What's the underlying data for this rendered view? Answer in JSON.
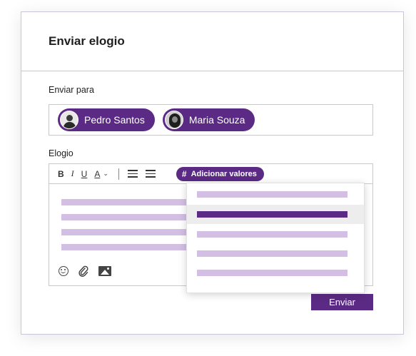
{
  "dialog": {
    "title": "Enviar elogio",
    "send_to_label": "Enviar para",
    "recipients": [
      {
        "name": "Pedro Santos"
      },
      {
        "name": "Maria Souza"
      }
    ],
    "message_label": "Elogio",
    "toolbar": {
      "bold": "B",
      "italic": "I",
      "underline": "U",
      "font_color": "A",
      "add_values": "Adicionar valores",
      "add_values_hash": "#"
    },
    "dropdown": {
      "item_count": 5,
      "highlighted_index": 1
    },
    "send_button": "Enviar"
  },
  "colors": {
    "accent": "#5b2a84",
    "placeholder_lines": "#d3bfe3"
  }
}
